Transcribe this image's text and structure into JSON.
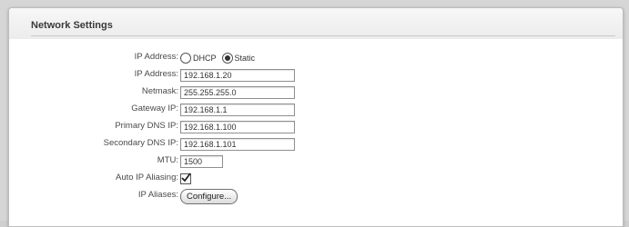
{
  "section": {
    "title": "Network Settings"
  },
  "fields": {
    "ip_mode": {
      "label": "IP Address:",
      "options": [
        "DHCP",
        "Static"
      ],
      "selected": "Static"
    },
    "ip_address": {
      "label": "IP Address:",
      "value": "192.168.1.20"
    },
    "netmask": {
      "label": "Netmask:",
      "value": "255.255.255.0"
    },
    "gateway": {
      "label": "Gateway IP:",
      "value": "192.168.1.1"
    },
    "primary_dns": {
      "label": "Primary DNS IP:",
      "value": "192.168.1.100"
    },
    "secondary_dns": {
      "label": "Secondary DNS IP:",
      "value": "192.168.1.101"
    },
    "mtu": {
      "label": "MTU:",
      "value": "1500"
    },
    "auto_ip_aliasing": {
      "label": "Auto IP Aliasing:",
      "checked": true
    },
    "ip_aliases": {
      "label": "IP Aliases:",
      "button_label": "Configure..."
    }
  }
}
